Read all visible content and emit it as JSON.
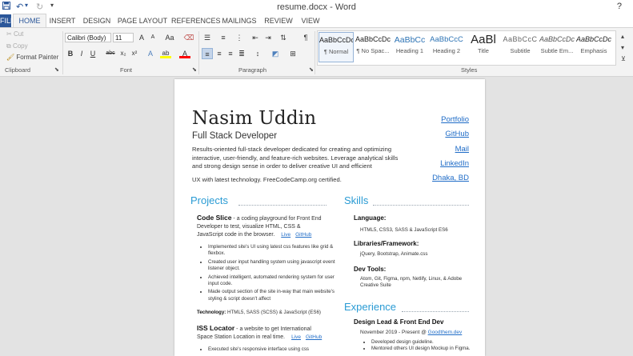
{
  "window": {
    "title": "resume.docx - Word",
    "help": "?"
  },
  "qat": {
    "save_icon": "save-icon",
    "undo_icon": "undo-icon",
    "redo_icon": "redo-icon",
    "customize_icon": "chevron-down-icon"
  },
  "tabs": [
    "FILE",
    "HOME",
    "INSERT",
    "DESIGN",
    "PAGE LAYOUT",
    "REFERENCES",
    "MAILINGS",
    "REVIEW",
    "VIEW"
  ],
  "ribbon": {
    "clipboard": {
      "cut": "Cut",
      "copy": "Copy",
      "format_painter": "Format Painter",
      "label": "Clipboard"
    },
    "font": {
      "family": "Calibri (Body)",
      "size": "11",
      "label": "Font",
      "bold": "B",
      "italic": "I",
      "underline": "U",
      "strike": "abc",
      "sub": "x₂",
      "sup": "x²",
      "grow": "A",
      "shrink": "A",
      "case": "Aa",
      "highlight": "ab",
      "color": "A"
    },
    "paragraph": {
      "label": "Paragraph",
      "show_marks": "¶"
    },
    "styles": {
      "label": "Styles",
      "items": [
        {
          "preview": "AaBbCcDc",
          "name": "¶ Normal"
        },
        {
          "preview": "AaBbCcDc",
          "name": "¶ No Spac..."
        },
        {
          "preview": "AaBbCc",
          "name": "Heading 1"
        },
        {
          "preview": "AaBbCcC",
          "name": "Heading 2"
        },
        {
          "preview": "AaBl",
          "name": "Title"
        },
        {
          "preview": "AaBbCcC",
          "name": "Subtitle"
        },
        {
          "preview": "AaBbCcDc",
          "name": "Subtle Em..."
        },
        {
          "preview": "AaBbCcDc",
          "name": "Emphasis"
        }
      ],
      "accent": "#2b579a"
    }
  },
  "doc": {
    "name": "Nasim Uddin",
    "role": "Full Stack Developer",
    "summary": "Results-oriented full-stack developer dedicated for creating and optimizing interactive, user-friendly, and feature-rich websites. Leverage analytical skills and strong design sense in order to deliver creative UI and efficient",
    "summary2": "UX with latest technology. FreeCodeCamp.org certified.",
    "links": [
      "Portfolio",
      "GitHub",
      "Mail",
      "LinkedIn",
      "Dhaka, BD"
    ],
    "projects": {
      "heading": "Projects",
      "p1": {
        "title": "Code Slice",
        "desc": " - a coding playground for Front End Developer to test, visualize HTML, CSS & JavaScript code in the browser.",
        "live": "Live",
        "github": "GitHub",
        "bullets": [
          "Implemented site's UI using latest css features like grid & flexbox.",
          "Created user input handling system using javascript event listener object.",
          "Achieved intelligent, automated rendering system for user input code.",
          "Made output section of the site in-way that main website's styling & script doesn't affect"
        ],
        "tech_label": "Technology:",
        "tech": " HTML5, SASS (SCSS) & JavaScript (ES6)"
      },
      "p2": {
        "title": "ISS Locator",
        "desc": " - a website to get International Space Station Location in real time.",
        "live": "Live",
        "github": "GitHub",
        "bullet": "Executed site's responsive interface using css"
      }
    },
    "skills": {
      "heading": "Skills",
      "language_h": "Language:",
      "language": "HTML5, CSS3, SASS & JavaScript ES6",
      "libs_h": "Libraries/Framework:",
      "libs": "jQuery, Bootstrap, Animate.css",
      "dev_h": "Dev Tools:",
      "dev": "Atom, Git, Figma, npm, Netlify, Linux, & Adobe Creative Suite"
    },
    "experience": {
      "heading": "Experience",
      "role": "Design Lead & Front End Dev",
      "date": "November 2019 - Present @ ",
      "company": "Goodthem.dev",
      "bullets": [
        "Developed design guideline.",
        "Mentored others UI design Mockup in Figma."
      ]
    }
  }
}
